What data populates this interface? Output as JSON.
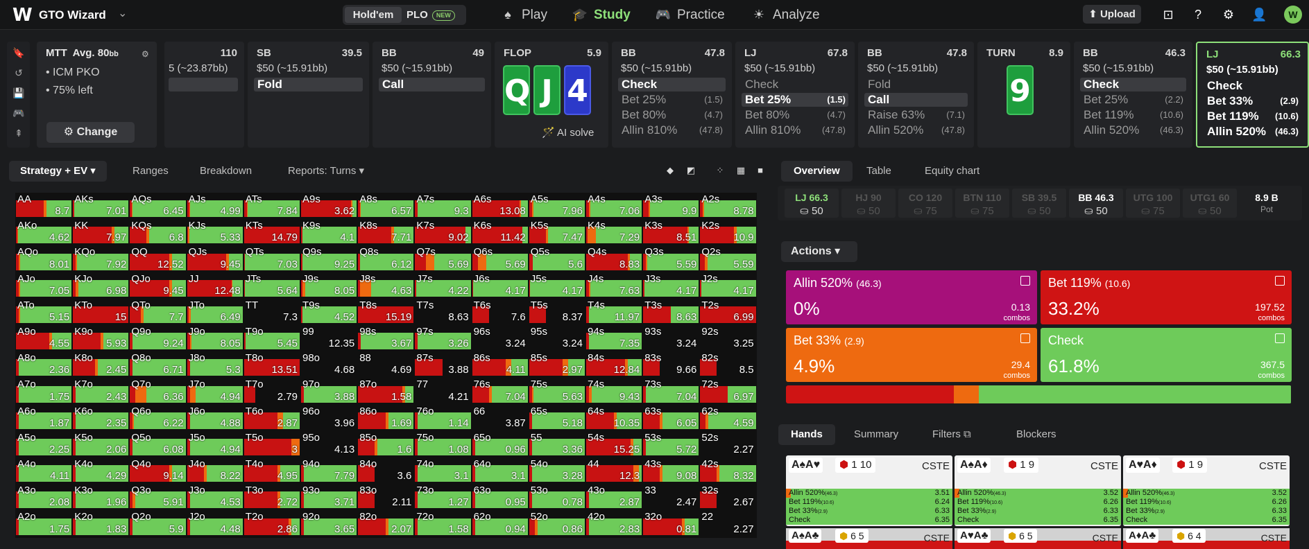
{
  "app": {
    "brand": "GTO Wizard",
    "game_modes": [
      "Hold'em",
      "PLO"
    ],
    "new_badge": "NEW",
    "nav": [
      {
        "label": "Play",
        "icon": "spade-icon"
      },
      {
        "label": "Study",
        "icon": "graduation-cap-icon",
        "active": true
      },
      {
        "label": "Practice",
        "icon": "gamepad-icon"
      },
      {
        "label": "Analyze",
        "icon": "sun-icon"
      }
    ],
    "upload": "Upload"
  },
  "mtt": {
    "format": "MTT",
    "avg": "Avg. 80",
    "avg_unit": "bb",
    "line1": "ICM PKO",
    "line2": "75% left",
    "change": "Change"
  },
  "spots": [
    {
      "head": "",
      "amt": "110",
      "stack": "5 (~23.87bb)",
      "actions": [],
      "partial": true
    },
    {
      "head": "SB",
      "amt": "39.5",
      "stack": "$50 (~15.91bb)",
      "actions": [
        {
          "l": "Fold",
          "s": "",
          "sel": true
        }
      ]
    },
    {
      "head": "BB",
      "amt": "49",
      "stack": "$50 (~15.91bb)",
      "actions": [
        {
          "l": "Call",
          "s": "",
          "sel": true
        }
      ]
    },
    {
      "head": "FLOP",
      "amt": "5.9",
      "type": "board",
      "cards": [
        "Q",
        "J",
        "4"
      ],
      "colors": [
        "g",
        "g",
        "b"
      ],
      "ai": "AI solve"
    },
    {
      "head": "BB",
      "amt": "47.8",
      "stack": "$50 (~15.91bb)",
      "actions": [
        {
          "l": "Check",
          "s": "",
          "sel": true
        },
        {
          "l": "Bet 25%",
          "s": "(1.5)"
        },
        {
          "l": "Bet 80%",
          "s": "(4.7)"
        },
        {
          "l": "Allin 810%",
          "s": "(47.8)"
        }
      ]
    },
    {
      "head": "LJ",
      "amt": "67.8",
      "stack": "$50 (~15.91bb)",
      "actions": [
        {
          "l": "Check",
          "s": ""
        },
        {
          "l": "Bet 25%",
          "s": "(1.5)",
          "sel": true
        },
        {
          "l": "Bet 80%",
          "s": "(4.7)"
        },
        {
          "l": "Allin 810%",
          "s": "(47.8)"
        }
      ]
    },
    {
      "head": "BB",
      "amt": "47.8",
      "stack": "$50 (~15.91bb)",
      "actions": [
        {
          "l": "Fold",
          "s": ""
        },
        {
          "l": "Call",
          "s": "",
          "sel": true
        },
        {
          "l": "Raise 63%",
          "s": "(7.1)"
        },
        {
          "l": "Allin 520%",
          "s": "(47.8)"
        }
      ]
    },
    {
      "head": "TURN",
      "amt": "8.9",
      "type": "board",
      "cards": [
        "9"
      ],
      "colors": [
        "g"
      ]
    },
    {
      "head": "BB",
      "amt": "46.3",
      "stack": "$50 (~15.91bb)",
      "actions": [
        {
          "l": "Check",
          "s": "",
          "sel": true
        },
        {
          "l": "Bet 25%",
          "s": "(2.2)"
        },
        {
          "l": "Bet 119%",
          "s": "(10.6)"
        },
        {
          "l": "Allin 520%",
          "s": "(46.3)"
        }
      ]
    },
    {
      "head": "LJ",
      "amt": "66.3",
      "stack": "$50 (~15.91bb)",
      "current": true,
      "actions": [
        {
          "l": "Check",
          "s": ""
        },
        {
          "l": "Bet 33%",
          "s": "(2.9)"
        },
        {
          "l": "Bet 119%",
          "s": "(10.6)"
        },
        {
          "l": "Allin 520%",
          "s": "(46.3)"
        }
      ]
    }
  ],
  "left_tabs": [
    "Strategy + EV",
    "Ranges",
    "Breakdown",
    "Reports: Turns"
  ],
  "right_tabs": [
    "Overview",
    "Table",
    "Equity chart"
  ],
  "positions": [
    {
      "n": "LJ 66.3",
      "s": "50",
      "st": "on"
    },
    {
      "n": "HJ 90",
      "s": "50"
    },
    {
      "n": "CO 120",
      "s": "75"
    },
    {
      "n": "BTN 110",
      "s": "75"
    },
    {
      "n": "SB 39.5",
      "s": "50"
    },
    {
      "n": "BB 46.3",
      "s": "50",
      "st": "cur"
    },
    {
      "n": "UTG 100",
      "s": "75"
    },
    {
      "n": "UTG1 60",
      "s": "50"
    },
    {
      "n": "8.9 B",
      "s": "Pot",
      "st": "pot"
    }
  ],
  "actions_label": "Actions",
  "actions": [
    {
      "name": "Allin 520%",
      "size": "(46.3)",
      "pct": "0%",
      "combos": "0.13",
      "color": "#a6107a"
    },
    {
      "name": "Bet 119%",
      "size": "(10.6)",
      "pct": "33.2%",
      "combos": "197.52",
      "color": "#cf1414"
    },
    {
      "name": "Bet 33%",
      "size": "(2.9)",
      "pct": "4.9%",
      "combos": "29.4",
      "color": "#ee6a10"
    },
    {
      "name": "Check",
      "size": "",
      "pct": "61.8%",
      "combos": "367.5",
      "color": "#6ecb5a"
    }
  ],
  "combos_word": "combos",
  "dist": {
    "allin": 0.0,
    "bet119": 33.2,
    "bet33": 4.9,
    "check": 61.8
  },
  "bottom_tabs": [
    "Hands",
    "Summary",
    "Filters",
    "Blockers"
  ],
  "hand_cards": [
    {
      "cards": "A♠A♥",
      "tag": "1  10",
      "cste": "CSTE",
      "rows": [
        [
          "Allin 520%",
          "(46.3)",
          "3.51",
          0
        ],
        [
          "Bet 119%",
          "(10.6)",
          "6.24",
          0
        ],
        [
          "Bet 33%",
          "(2.9)",
          "6.33",
          0
        ],
        [
          "Check",
          "",
          "6.35",
          0
        ]
      ]
    },
    {
      "cards": "A♠A♦",
      "tag": "1  9",
      "cste": "CSTE",
      "rows": [
        [
          "Allin 520%",
          "(46.3)",
          "3.52",
          0
        ],
        [
          "Bet 119%",
          "(10.6)",
          "6.26",
          0
        ],
        [
          "Bet 33%",
          "(2.9)",
          "6.33",
          0
        ],
        [
          "Check",
          "",
          "6.35",
          0
        ]
      ]
    },
    {
      "cards": "A♥A♦",
      "tag": "1  9",
      "cste": "CSTE",
      "rows": [
        [
          "Allin 520%",
          "(46.3)",
          "3.52",
          0
        ],
        [
          "Bet 119%",
          "(10.6)",
          "6.26",
          0
        ],
        [
          "Bet 33%",
          "(2.9)",
          "6.33",
          0
        ],
        [
          "Check",
          "",
          "6.35",
          0
        ]
      ]
    }
  ],
  "hand_bottom": [
    {
      "cards": "A♠A♣",
      "tag": "6  5",
      "cste": "CSTE"
    },
    {
      "cards": "A♥A♣",
      "tag": "6  5",
      "cste": "CSTE"
    },
    {
      "cards": "A♦A♣",
      "tag": "6  4",
      "cste": "CSTE"
    }
  ],
  "grid": [
    [
      "AA",
      "8.7",
      "r",
      0.5,
      0.05
    ],
    [
      "AKs",
      "7.01",
      "g",
      0.02,
      0
    ],
    [
      "AQs",
      "6.45",
      "g",
      0.03,
      0.02
    ],
    [
      "AJs",
      "4.99",
      "g",
      0.04,
      0.02
    ],
    [
      "ATs",
      "7.84",
      "g",
      0.05,
      0.02
    ],
    [
      "A9s",
      "3.62",
      "r",
      0.9,
      0.02
    ],
    [
      "A8s",
      "6.57",
      "g",
      0.03,
      0.02
    ],
    [
      "A7s",
      "9.3",
      "g",
      0.05,
      0
    ],
    [
      "A6s",
      "13.08",
      "r",
      0.85,
      0.03
    ],
    [
      "A5s",
      "7.96",
      "g",
      0.05,
      0.03
    ],
    [
      "A4s",
      "7.06",
      "g",
      0.05,
      0.03
    ],
    [
      "A3s",
      "9.9",
      "g",
      0.1,
      0.02
    ],
    [
      "A2s",
      "8.78",
      "g",
      0.05,
      0.02
    ],
    [
      "AKo",
      "4.62",
      "g",
      0.02,
      0.02
    ],
    [
      "KK",
      "7.97",
      "r",
      0.7,
      0.04
    ],
    [
      "KQs",
      "6.8",
      "g",
      0.3,
      0.04
    ],
    [
      "KJs",
      "5.33",
      "g",
      0.02,
      0.02
    ],
    [
      "KTs",
      "14.79",
      "r",
      1,
      0
    ],
    [
      "K9s",
      "4.1",
      "g",
      0.03,
      0
    ],
    [
      "K8s",
      "7.71",
      "r",
      0.6,
      0.04
    ],
    [
      "K7s",
      "9.02",
      "r",
      0.9,
      0
    ],
    [
      "K6s",
      "11.42",
      "r",
      0.9,
      0
    ],
    [
      "K5s",
      "7.47",
      "g",
      0.3,
      0.04
    ],
    [
      "K4s",
      "7.29",
      "g",
      0.02,
      0.15
    ],
    [
      "K3s",
      "8.51",
      "r",
      0.8,
      0.02
    ],
    [
      "K2s",
      "10.9",
      "r",
      0.6,
      0.05
    ],
    [
      "AQo",
      "8.01",
      "g",
      0.05,
      0.03
    ],
    [
      "KQo",
      "7.92",
      "g",
      0.05,
      0.02
    ],
    [
      "QQ",
      "12.52",
      "r",
      0.7,
      0.05
    ],
    [
      "QJs",
      "9.45",
      "r",
      0.7,
      0.05
    ],
    [
      "QTs",
      "7.03",
      "g",
      0.02,
      0
    ],
    [
      "Q9s",
      "9.25",
      "g",
      0.02,
      0
    ],
    [
      "Q8s",
      "6.12",
      "g",
      0.04,
      0
    ],
    [
      "Q7s",
      "5.69",
      "g",
      0.2,
      0.15
    ],
    [
      "Q6s",
      "5.69",
      "g",
      0.1,
      0.15
    ],
    [
      "Q5s",
      "5.6",
      "g",
      0.06,
      0
    ],
    [
      "Q4s",
      "8.83",
      "r",
      0.75,
      0.03
    ],
    [
      "Q3s",
      "5.59",
      "g",
      0.05,
      0.02
    ],
    [
      "Q2s",
      "5.59",
      "g",
      0.08,
      0.05
    ],
    [
      "AJo",
      "7.05",
      "g",
      0.05,
      0.03
    ],
    [
      "KJo",
      "6.98",
      "g",
      0.05,
      0.05
    ],
    [
      "QJo",
      "9.45",
      "r",
      0.7,
      0.05
    ],
    [
      "JJ",
      "12.48",
      "r",
      0.8,
      0.02
    ],
    [
      "JTs",
      "5.64",
      "g",
      0.02,
      0
    ],
    [
      "J9s",
      "8.05",
      "g",
      0.02,
      0.05
    ],
    [
      "J8s",
      "4.63",
      "g",
      0.03,
      0.2
    ],
    [
      "J7s",
      "4.22",
      "g",
      0.02,
      0
    ],
    [
      "J6s",
      "4.17",
      "g",
      0.02,
      0
    ],
    [
      "J5s",
      "4.17",
      "g",
      0.02,
      0
    ],
    [
      "J4s",
      "7.63",
      "g",
      0.05,
      0.02
    ],
    [
      "J3s",
      "4.17",
      "g",
      0.02,
      0
    ],
    [
      "J2s",
      "4.17",
      "g",
      0.02,
      0
    ],
    [
      "ATo",
      "5.15",
      "g",
      0.05,
      0.03
    ],
    [
      "KTo",
      "15",
      "r",
      1,
      0
    ],
    [
      "QTo",
      "7.7",
      "g",
      0.2,
      0.05
    ],
    [
      "JTo",
      "6.49",
      "g",
      0.03,
      0.04
    ],
    [
      "TT",
      "7.3",
      "k",
      0,
      0
    ],
    [
      "T9s",
      "4.52",
      "g",
      0.03,
      0
    ],
    [
      "T8s",
      "15.19",
      "r",
      1,
      0
    ],
    [
      "T7s",
      "8.63",
      "k",
      0,
      0
    ],
    [
      "T6s",
      "7.6",
      "k",
      0.3,
      0
    ],
    [
      "T5s",
      "8.37",
      "k",
      0.3,
      0
    ],
    [
      "T4s",
      "11.97",
      "g",
      0.05,
      0
    ],
    [
      "T3s",
      "8.63",
      "r",
      0.5,
      0
    ],
    [
      "T2s",
      "6.99",
      "r",
      1,
      0
    ],
    [
      "A9o",
      "4.55",
      "r",
      0.6,
      0.05
    ],
    [
      "K9o",
      "5.93",
      "r",
      0.5,
      0.05
    ],
    [
      "Q9o",
      "9.24",
      "g",
      0.05,
      0
    ],
    [
      "J9o",
      "8.05",
      "g",
      0.05,
      0.03
    ],
    [
      "T9o",
      "5.45",
      "g",
      0.03,
      0
    ],
    [
      "99",
      "12.35",
      "k",
      0,
      0
    ],
    [
      "98s",
      "3.67",
      "g",
      0.05,
      0
    ],
    [
      "97s",
      "3.26",
      "g",
      0.05,
      0
    ],
    [
      "96s",
      "3.24",
      "k",
      0,
      0
    ],
    [
      "95s",
      "3.24",
      "k",
      0,
      0
    ],
    [
      "94s",
      "7.35",
      "g",
      0.05,
      0
    ],
    [
      "93s",
      "3.24",
      "k",
      0,
      0
    ],
    [
      "92s",
      "3.25",
      "k",
      0,
      0
    ],
    [
      "A8o",
      "2.36",
      "g",
      0.05,
      0
    ],
    [
      "K8o",
      "2.45",
      "g",
      0.4,
      0.05
    ],
    [
      "Q8o",
      "6.71",
      "g",
      0.05,
      0
    ],
    [
      "J8o",
      "5.3",
      "g",
      0.05,
      0
    ],
    [
      "T8o",
      "13.51",
      "r",
      1,
      0
    ],
    [
      "98o",
      "4.68",
      "k",
      0,
      0
    ],
    [
      "88",
      "4.69",
      "k",
      0,
      0
    ],
    [
      "87s",
      "3.88",
      "k",
      0.5,
      0
    ],
    [
      "86s",
      "4.11",
      "r",
      0.6,
      0.1
    ],
    [
      "85s",
      "2.97",
      "r",
      0.6,
      0.1
    ],
    [
      "84s",
      "12.84",
      "r",
      0.7,
      0.05
    ],
    [
      "83s",
      "9.66",
      "k",
      0.3,
      0
    ],
    [
      "82s",
      "8.5",
      "k",
      0.3,
      0
    ],
    [
      "A7o",
      "1.75",
      "g",
      0.05,
      0
    ],
    [
      "K7o",
      "2.43",
      "g",
      0.05,
      0
    ],
    [
      "Q7o",
      "6.36",
      "g",
      0.1,
      0.2
    ],
    [
      "J7o",
      "4.94",
      "g",
      0.05,
      0.1
    ],
    [
      "T7o",
      "2.79",
      "k",
      0.2,
      0
    ],
    [
      "97o",
      "3.88",
      "g",
      0.05,
      0
    ],
    [
      "87o",
      "1.58",
      "r",
      0.8,
      0.05
    ],
    [
      "77",
      "4.21",
      "k",
      0,
      0
    ],
    [
      "76s",
      "7.04",
      "g",
      0.3,
      0.05
    ],
    [
      "75s",
      "5.63",
      "g",
      0.05,
      0.03
    ],
    [
      "74s",
      "9.43",
      "g",
      0.05,
      0.05
    ],
    [
      "73s",
      "7.04",
      "g",
      0.05,
      0
    ],
    [
      "72s",
      "6.97",
      "r",
      0.5,
      0
    ],
    [
      "A6o",
      "1.87",
      "g",
      0.05,
      0
    ],
    [
      "K6o",
      "2.35",
      "g",
      0.05,
      0
    ],
    [
      "Q6o",
      "6.22",
      "g",
      0.05,
      0.02
    ],
    [
      "J6o",
      "4.88",
      "g",
      0.05,
      0
    ],
    [
      "T6o",
      "2.87",
      "r",
      0.6,
      0.1
    ],
    [
      "96o",
      "3.96",
      "k",
      0,
      0
    ],
    [
      "86o",
      "1.69",
      "r",
      0.5,
      0.05
    ],
    [
      "76o",
      "1.14",
      "g",
      0.05,
      0
    ],
    [
      "66",
      "3.87",
      "k",
      0,
      0
    ],
    [
      "65s",
      "5.18",
      "g",
      0.05,
      0
    ],
    [
      "64s",
      "10.35",
      "r",
      0.5,
      0.05
    ],
    [
      "63s",
      "6.05",
      "g",
      0.3,
      0.05
    ],
    [
      "62s",
      "4.59",
      "g",
      0.1,
      0.05
    ],
    [
      "A5o",
      "2.25",
      "g",
      0.05,
      0
    ],
    [
      "K5o",
      "2.06",
      "g",
      0.05,
      0
    ],
    [
      "Q5o",
      "6.08",
      "g",
      0.05,
      0
    ],
    [
      "J5o",
      "4.94",
      "g",
      0.05,
      0
    ],
    [
      "T5o",
      "3",
      "r",
      0.85,
      0.15
    ],
    [
      "95o",
      "4.13",
      "k",
      0,
      0
    ],
    [
      "85o",
      "1.6",
      "r",
      0.3,
      0.05
    ],
    [
      "75o",
      "1.08",
      "g",
      0.05,
      0
    ],
    [
      "65o",
      "0.96",
      "g",
      0.05,
      0
    ],
    [
      "55",
      "3.36",
      "g",
      0.05,
      0
    ],
    [
      "54s",
      "15.25",
      "r",
      0.8,
      0.05
    ],
    [
      "53s",
      "5.72",
      "g",
      0.05,
      0
    ],
    [
      "52s",
      "2.27",
      "k",
      0,
      0
    ],
    [
      "A4o",
      "4.11",
      "g",
      0.05,
      0
    ],
    [
      "K4o",
      "4.29",
      "g",
      0.05,
      0
    ],
    [
      "Q4o",
      "9.14",
      "r",
      0.7,
      0.05
    ],
    [
      "J4o",
      "8.22",
      "g",
      0.3,
      0.05
    ],
    [
      "T4o",
      "4.95",
      "r",
      0.6,
      0.05
    ],
    [
      "94o",
      "7.79",
      "g",
      0.05,
      0
    ],
    [
      "84o",
      "3.6",
      "k",
      0.3,
      0
    ],
    [
      "74o",
      "3.1",
      "g",
      0.05,
      0
    ],
    [
      "64o",
      "3.1",
      "g",
      0.05,
      0
    ],
    [
      "54o",
      "3.28",
      "g",
      0.05,
      0
    ],
    [
      "44",
      "12.3",
      "r",
      0.85,
      0.1
    ],
    [
      "43s",
      "9.08",
      "g",
      0.3,
      0.05
    ],
    [
      "42s",
      "8.32",
      "g",
      0.3,
      0.05
    ],
    [
      "A3o",
      "2.08",
      "g",
      0.05,
      0
    ],
    [
      "K3o",
      "1.96",
      "g",
      0.05,
      0
    ],
    [
      "Q3o",
      "5.91",
      "g",
      0.05,
      0.05
    ],
    [
      "J3o",
      "4.53",
      "g",
      0.05,
      0
    ],
    [
      "T3o",
      "2.72",
      "r",
      0.6,
      0.05
    ],
    [
      "93o",
      "3.71",
      "g",
      0.05,
      0
    ],
    [
      "83o",
      "2.11",
      "k",
      0.3,
      0
    ],
    [
      "73o",
      "1.27",
      "g",
      0.05,
      0
    ],
    [
      "63o",
      "0.95",
      "g",
      0.05,
      0
    ],
    [
      "53o",
      "0.78",
      "g",
      0.05,
      0
    ],
    [
      "43o",
      "2.87",
      "g",
      0.05,
      0
    ],
    [
      "33",
      "2.47",
      "k",
      0,
      0
    ],
    [
      "32s",
      "2.67",
      "k",
      0.3,
      0
    ],
    [
      "A2o",
      "1.75",
      "g",
      0.05,
      0
    ],
    [
      "K2o",
      "1.83",
      "g",
      0.05,
      0
    ],
    [
      "Q2o",
      "5.9",
      "g",
      0.05,
      0
    ],
    [
      "J2o",
      "4.48",
      "g",
      0.05,
      0
    ],
    [
      "T2o",
      "2.86",
      "r",
      0.8,
      0.05
    ],
    [
      "92o",
      "3.65",
      "g",
      0.05,
      0
    ],
    [
      "82o",
      "2.07",
      "r",
      0.5,
      0.05
    ],
    [
      "72o",
      "1.58",
      "g",
      0.05,
      0
    ],
    [
      "62o",
      "0.94",
      "g",
      0.05,
      0
    ],
    [
      "52o",
      "0.86",
      "g",
      0.1,
      0.05
    ],
    [
      "42o",
      "2.83",
      "g",
      0.05,
      0
    ],
    [
      "32o",
      "0.81",
      "r",
      0.7,
      0.05
    ],
    [
      "22",
      "2.27",
      "k",
      0,
      0
    ]
  ]
}
